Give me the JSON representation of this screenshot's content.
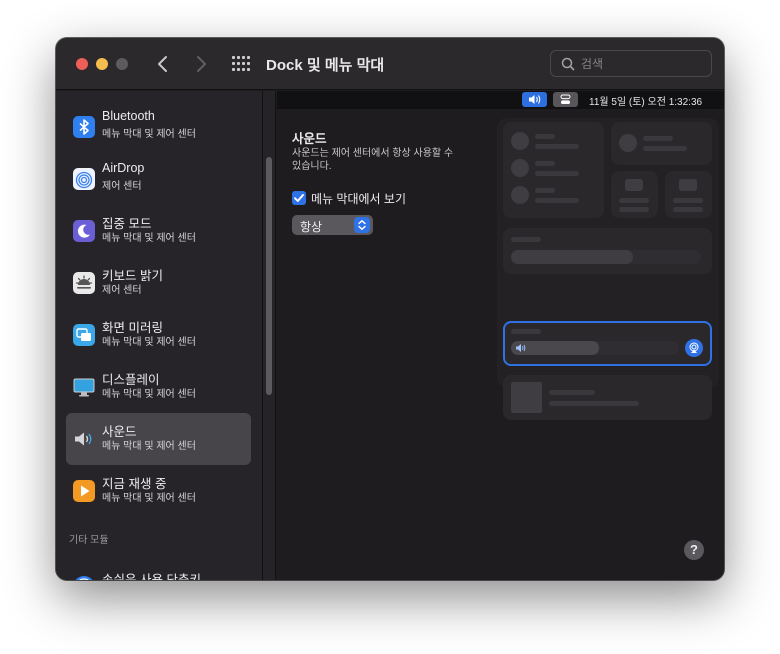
{
  "window": {
    "title": "Dock 및 메뉴 막대",
    "search_placeholder": "검색"
  },
  "sidebar": {
    "items": [
      {
        "name": "Bluetooth",
        "sub": "메뉴 막대 및 제어 센터",
        "icon": "bluetooth-icon",
        "color": "#2f7ff0"
      },
      {
        "name": "AirDrop",
        "sub": "제어 센터",
        "icon": "airdrop-icon",
        "color": "#eef3ff"
      },
      {
        "name": "집중 모드",
        "sub": "메뉴 막대 및 제어 센터",
        "icon": "moon-icon",
        "color": "#6b5fd6"
      },
      {
        "name": "키보드 밝기",
        "sub": "제어 센터",
        "icon": "keyboard-brightness-icon",
        "color": "#e9e9ea"
      },
      {
        "name": "화면 미러링",
        "sub": "메뉴 막대 및 제어 센터",
        "icon": "screen-mirroring-icon",
        "color": "#3aa7e8"
      },
      {
        "name": "디스플레이",
        "sub": "메뉴 막대 및 제어 센터",
        "icon": "display-icon",
        "color": "#35a2e0"
      },
      {
        "name": "사운드",
        "sub": "메뉴 막대 및 제어 센터",
        "icon": "speaker-icon",
        "color": "#cfcfd1",
        "selected": true
      },
      {
        "name": "지금 재생 중",
        "sub": "메뉴 막대 및 제어 센터",
        "icon": "play-icon",
        "color": "#f29a24"
      }
    ],
    "section_other": "기타 모듈",
    "partial_item": {
      "name": "손쉬운 사용 단축키",
      "icon": "accessibility-icon",
      "color": "#2f7ff0"
    }
  },
  "menubar_preview": {
    "clock": "11월 5일 (토) 오전  1:32:36"
  },
  "sound_section": {
    "title": "사운드",
    "description": "사운드는 제어 센터에서 항상 사용할 수 있습니다.",
    "checkbox_label": "메뉴 막대에서 보기",
    "checkbox_checked": true,
    "popup_value": "항상"
  },
  "help": {
    "label": "?"
  },
  "colors": {
    "accent": "#2f72e5",
    "window_bg": "#1e1c1f",
    "sidebar_bg": "#262428"
  }
}
